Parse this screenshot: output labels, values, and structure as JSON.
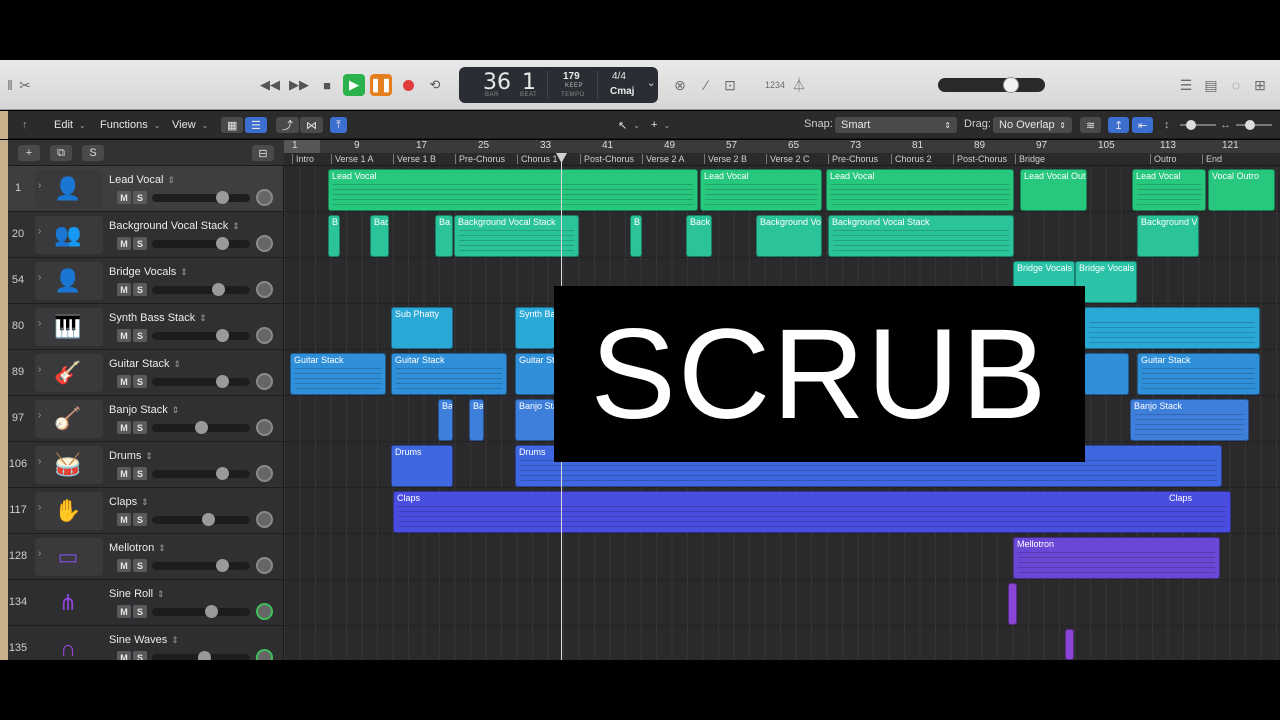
{
  "transport": {
    "bar": "36",
    "beat": "1",
    "bar_label": "BAR",
    "beat_label": "BEAT",
    "tempo": "179",
    "tempo_mode": "KEEP",
    "tempo_label": "TEMPO",
    "signature": "4/4",
    "key": "Cmaj",
    "count_in": "1234"
  },
  "toolbar": {
    "edit": "Edit",
    "functions": "Functions",
    "view": "View",
    "snap_label": "Snap:",
    "snap_value": "Smart",
    "drag_label": "Drag:",
    "drag_value": "No Overlap"
  },
  "track_header": {
    "add": "+",
    "dup": "⧉",
    "solo": "S"
  },
  "ruler": [
    "1",
    "9",
    "17",
    "25",
    "33",
    "41",
    "49",
    "57",
    "65",
    "73",
    "81",
    "89",
    "97",
    "105",
    "113",
    "121"
  ],
  "markers": [
    "Intro",
    "Verse 1 A",
    "Verse 1 B",
    "Pre-Chorus",
    "Chorus 1",
    "Post-Chorus",
    "Verse 2 A",
    "Verse 2 B",
    "Verse 2 C",
    "Pre-Chorus",
    "Chorus 2",
    "Post-Chorus",
    "Bridge",
    "Outro",
    "End"
  ],
  "tracks": [
    {
      "num": "1",
      "name": "Lead Vocal",
      "icon": "singer-icon",
      "color": "#2fcf8a",
      "m": "M",
      "s": "S"
    },
    {
      "num": "20",
      "name": "Background Vocal Stack",
      "icon": "choir-icon",
      "color": "#2fcf9a",
      "m": "M",
      "s": "S"
    },
    {
      "num": "54",
      "name": "Bridge Vocals",
      "icon": "singer-icon",
      "color": "#2ac3a8",
      "m": "M",
      "s": "S"
    },
    {
      "num": "80",
      "name": "Synth Bass Stack",
      "icon": "keyboard-icon",
      "color": "#2aa8d6",
      "m": "M",
      "s": "S"
    },
    {
      "num": "89",
      "name": "Guitar Stack",
      "icon": "guitar-icon",
      "color": "#2f8fd8",
      "m": "M",
      "s": "S"
    },
    {
      "num": "97",
      "name": "Banjo Stack",
      "icon": "banjo-icon",
      "color": "#3f7fdc",
      "m": "M",
      "s": "S"
    },
    {
      "num": "106",
      "name": "Drums",
      "icon": "drums-icon",
      "color": "#4a6ae0",
      "m": "M",
      "s": "S"
    },
    {
      "num": "117",
      "name": "Claps",
      "icon": "hand-icon",
      "color": "#5a55e0",
      "m": "M",
      "s": "S"
    },
    {
      "num": "128",
      "name": "Mellotron",
      "icon": "mellotron-icon",
      "color": "#7a4ed8",
      "m": "M",
      "s": "S"
    },
    {
      "num": "134",
      "name": "Sine Roll",
      "icon": "synth-icon",
      "color": "#8a45d8",
      "m": "M",
      "s": "S"
    },
    {
      "num": "135",
      "name": "Sine Waves",
      "icon": "wave-icon",
      "color": "#9a45d8",
      "m": "M",
      "s": "S"
    }
  ],
  "regions": {
    "lead_vocal": "Lead Vocal",
    "lead_vocal_out": "Lead Vocal Out",
    "vocal_outro": "Vocal Outro",
    "bv_short_b": "B",
    "bv_short_bac": "Bac",
    "bv_short_ba": "Ba",
    "bv_stack": "Background Vocal Stack",
    "bv_short_back": "Back",
    "bv_vo": "Background Vo",
    "bv_v": "Background V",
    "bridge_vocals": "Bridge Vocals",
    "sub_phatty": "Sub Phatty",
    "synth_ba": "Synth Ba",
    "guitar_stack": "Guitar Stack",
    "guitar_st": "Guitar St",
    "banjo_ba": "Ba",
    "banjo_sta": "Banjo Sta",
    "banjo_stack": "Banjo Stack",
    "drums": "Drums",
    "claps": "Claps",
    "mellotron": "Mellotron"
  },
  "overlay": {
    "text": "SCRUB"
  }
}
